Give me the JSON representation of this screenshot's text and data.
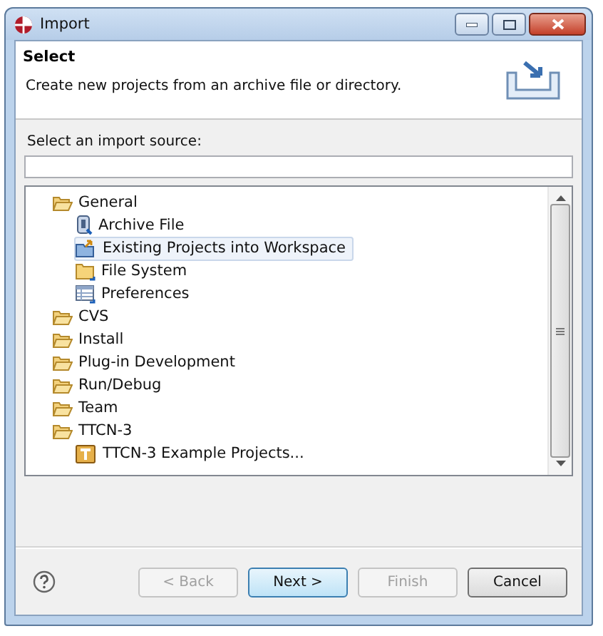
{
  "window": {
    "title": "Import"
  },
  "header": {
    "title": "Select",
    "description": "Create new projects from an archive file or directory."
  },
  "source_label": "Select an import source:",
  "tree": [
    {
      "label": "General",
      "kind": "folder",
      "selected": false,
      "children": [
        {
          "label": "Archive File",
          "kind": "archive",
          "selected": false
        },
        {
          "label": "Existing Projects into Workspace",
          "kind": "projects",
          "selected": true
        },
        {
          "label": "File System",
          "kind": "filesystem",
          "selected": false
        },
        {
          "label": "Preferences",
          "kind": "preferences",
          "selected": false
        }
      ]
    },
    {
      "label": "CVS",
      "kind": "folder",
      "selected": false
    },
    {
      "label": "Install",
      "kind": "folder",
      "selected": false
    },
    {
      "label": "Plug-in Development",
      "kind": "folder",
      "selected": false
    },
    {
      "label": "Run/Debug",
      "kind": "folder",
      "selected": false
    },
    {
      "label": "Team",
      "kind": "folder",
      "selected": false
    },
    {
      "label": "TTCN-3",
      "kind": "folder",
      "selected": false,
      "children": [
        {
          "label": "TTCN-3 Example Projects...",
          "kind": "ttcn",
          "selected": false
        }
      ]
    }
  ],
  "buttons": [
    {
      "label": "< Back",
      "disabled": true,
      "default": false
    },
    {
      "label": "Next >",
      "disabled": false,
      "default": true
    },
    {
      "label": "Finish",
      "disabled": true,
      "default": false
    },
    {
      "label": "Cancel",
      "disabled": false,
      "default": false
    }
  ]
}
